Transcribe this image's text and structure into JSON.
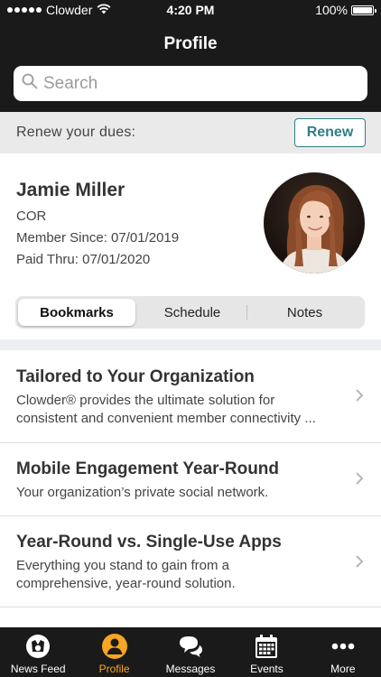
{
  "status_bar": {
    "carrier": "Clowder",
    "time": "4:20 PM",
    "battery": "100%",
    "battery_level": 1.0
  },
  "header": {
    "title": "Profile"
  },
  "search": {
    "placeholder": "Search"
  },
  "dues": {
    "label": "Renew your dues:",
    "button_label": "Renew"
  },
  "profile": {
    "name": "Jamie Miller",
    "role": "COR",
    "member_since": "Member Since: 07/01/2019",
    "paid_thru": "Paid Thru: 07/01/2020"
  },
  "segments": [
    {
      "label": "Bookmarks",
      "selected": true
    },
    {
      "label": "Schedule",
      "selected": false
    },
    {
      "label": "Notes",
      "selected": false
    }
  ],
  "bookmarks": [
    {
      "title": "Tailored to Your Organization",
      "description_lines": [
        "Clowder® provides the ultimate solution for",
        "consistent and convenient member connectivity ..."
      ]
    },
    {
      "title": "Mobile Engagement Year-Round",
      "description_lines": [
        "Your organization’s private social network."
      ]
    },
    {
      "title": "Year-Round vs. Single-Use Apps",
      "description_lines": [
        "Everything you stand to gain from a",
        "comprehensive, year-round solution."
      ]
    }
  ],
  "tabs": [
    {
      "label": "News Feed",
      "icon": "news-feed-logo-icon",
      "active": false
    },
    {
      "label": "Profile",
      "icon": "profile-person-icon",
      "active": true
    },
    {
      "label": "Messages",
      "icon": "chat-bubbles-icon",
      "active": false
    },
    {
      "label": "Events",
      "icon": "calendar-icon",
      "active": false
    },
    {
      "label": "More",
      "icon": "more-dots-icon",
      "active": false
    }
  ],
  "colors": {
    "header_bg": "#1a1a1a",
    "accent_teal": "#2f7f86",
    "active_tab": "#f6a623",
    "banner_bg": "#eaeaea"
  }
}
